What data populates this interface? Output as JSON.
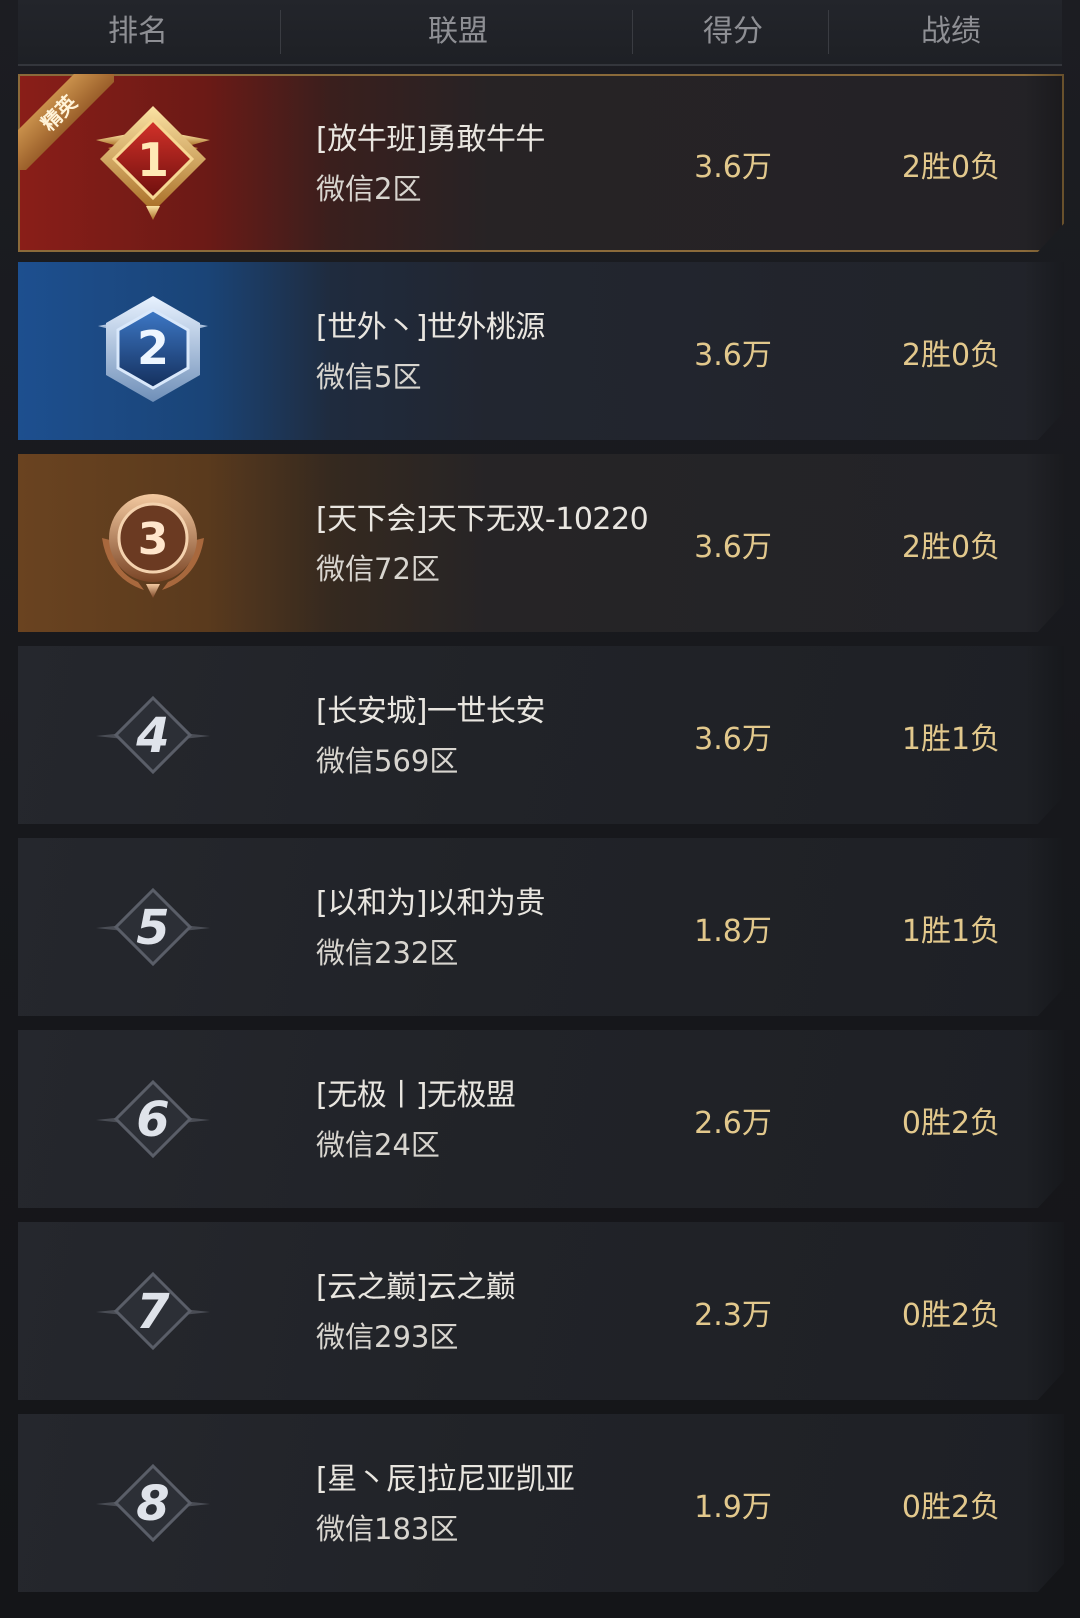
{
  "header": {
    "rank": "排名",
    "alliance": "联盟",
    "score": "得分",
    "record": "战绩"
  },
  "ribbon_label": "精英",
  "rows": [
    {
      "rank": "1",
      "name": "[放牛班]勇敢牛牛",
      "server": "微信2区",
      "score": "3.6万",
      "record": "2胜0负",
      "badge_style": "gold-red"
    },
    {
      "rank": "2",
      "name": "[世外丶]世外桃源",
      "server": "微信5区",
      "score": "3.6万",
      "record": "2胜0负",
      "badge_style": "silver-blue"
    },
    {
      "rank": "3",
      "name": "[天下会]天下无双-10220",
      "server": "微信72区",
      "score": "3.6万",
      "record": "2胜0负",
      "badge_style": "bronze"
    },
    {
      "rank": "4",
      "name": "[长安城]一世长安",
      "server": "微信569区",
      "score": "3.6万",
      "record": "1胜1负",
      "badge_style": "plain"
    },
    {
      "rank": "5",
      "name": "[以和为]以和为贵",
      "server": "微信232区",
      "score": "1.8万",
      "record": "1胜1负",
      "badge_style": "plain"
    },
    {
      "rank": "6",
      "name": "[无极丨]无极盟",
      "server": "微信24区",
      "score": "2.6万",
      "record": "0胜2负",
      "badge_style": "plain"
    },
    {
      "rank": "7",
      "name": "[云之巅]云之巅",
      "server": "微信293区",
      "score": "2.3万",
      "record": "0胜2负",
      "badge_style": "plain"
    },
    {
      "rank": "8",
      "name": "[星丶辰]拉尼亚凯亚",
      "server": "微信183区",
      "score": "1.9万",
      "record": "0胜2负",
      "badge_style": "plain"
    }
  ]
}
